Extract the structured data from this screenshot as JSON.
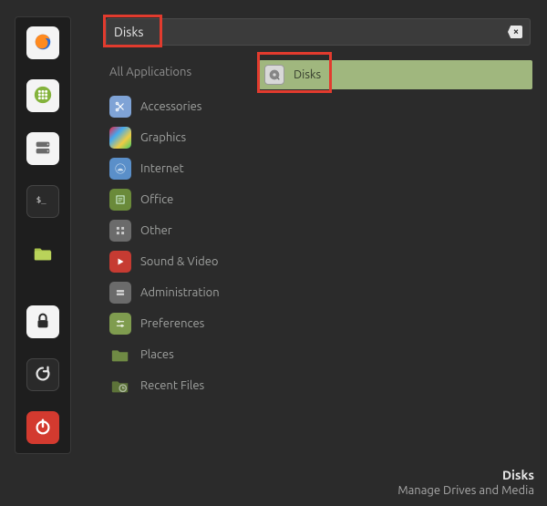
{
  "search": {
    "value": "Disks"
  },
  "sidebar": {
    "items": [
      {
        "name": "firefox-icon"
      },
      {
        "name": "apps-grid-icon"
      },
      {
        "name": "disks-icon"
      },
      {
        "name": "terminal-icon"
      },
      {
        "name": "files-icon"
      },
      {
        "name": "lock-icon"
      },
      {
        "name": "refresh-icon"
      },
      {
        "name": "power-icon"
      }
    ]
  },
  "categories": {
    "header": "All Applications",
    "items": [
      {
        "label": "Accessories",
        "icon": "scissors-icon"
      },
      {
        "label": "Graphics",
        "icon": "graphics-icon"
      },
      {
        "label": "Internet",
        "icon": "internet-icon"
      },
      {
        "label": "Office",
        "icon": "office-icon"
      },
      {
        "label": "Other",
        "icon": "other-icon"
      },
      {
        "label": "Sound & Video",
        "icon": "media-icon"
      },
      {
        "label": "Administration",
        "icon": "admin-icon"
      },
      {
        "label": "Preferences",
        "icon": "prefs-icon"
      },
      {
        "label": "Places",
        "icon": "places-icon"
      },
      {
        "label": "Recent Files",
        "icon": "recent-icon"
      }
    ]
  },
  "results": {
    "items": [
      {
        "label": "Disks",
        "icon": "disk-utility-icon"
      }
    ]
  },
  "footer": {
    "title": "Disks",
    "description": "Manage Drives and Media"
  }
}
